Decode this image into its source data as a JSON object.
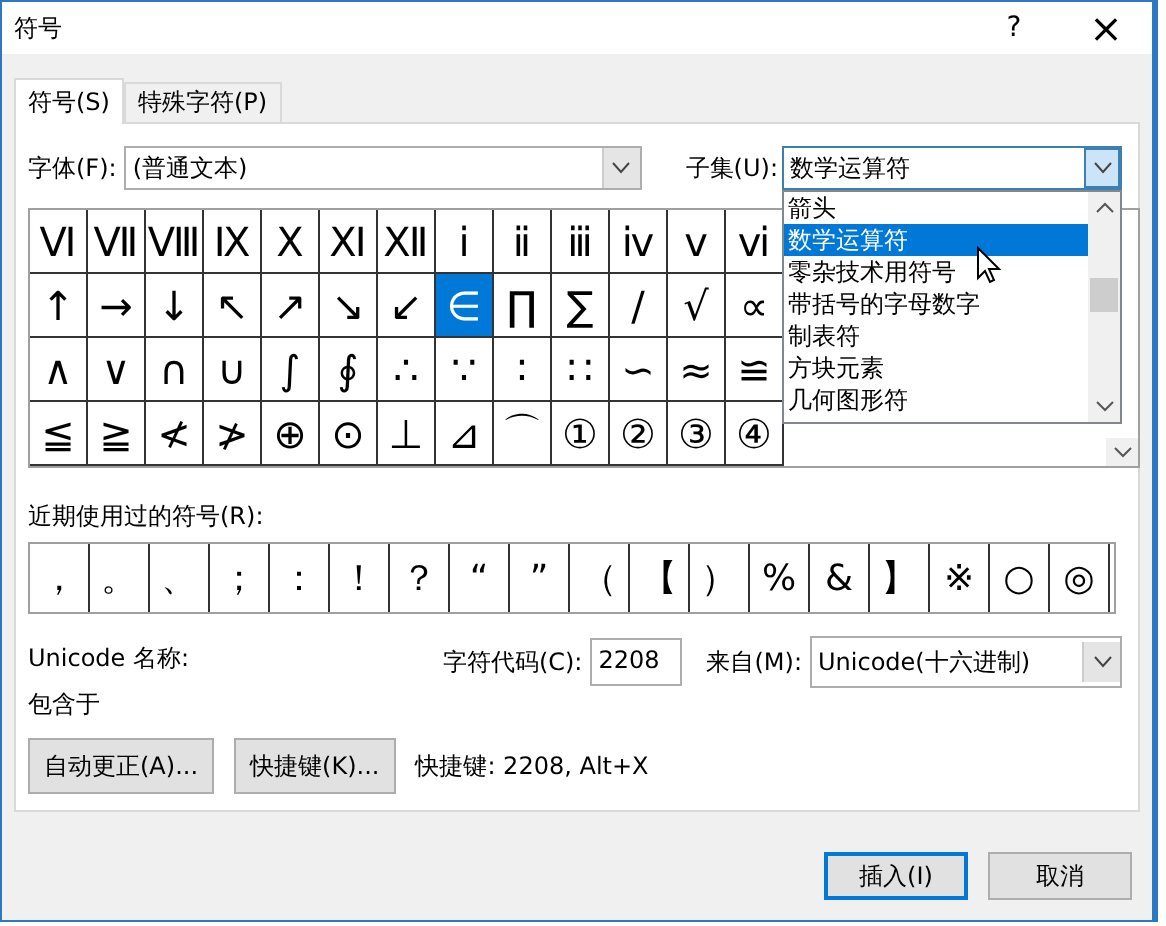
{
  "window": {
    "title": "符号",
    "help": "?",
    "close": "×"
  },
  "tabs": [
    {
      "label": "符号(S)",
      "selected": true
    },
    {
      "label": "特殊字符(P)",
      "selected": false
    }
  ],
  "font": {
    "label": "字体(F):",
    "value": "(普通文本)"
  },
  "subset": {
    "label": "子集(U):",
    "value": "数学运算符",
    "expanded": true,
    "options": [
      {
        "label": "箭头",
        "selected": false
      },
      {
        "label": "数学运算符",
        "selected": true
      },
      {
        "label": "零杂技术用符号",
        "selected": false
      },
      {
        "label": "带括号的字母数字",
        "selected": false
      },
      {
        "label": "制表符",
        "selected": false
      },
      {
        "label": "方块元素",
        "selected": false
      },
      {
        "label": "几何图形符",
        "selected": false
      }
    ]
  },
  "symbols": [
    [
      {
        "c": "Ⅵ",
        "selected": false
      },
      {
        "c": "Ⅶ",
        "selected": false
      },
      {
        "c": "Ⅷ",
        "selected": false
      },
      {
        "c": "Ⅸ",
        "selected": false
      },
      {
        "c": "Ⅹ",
        "selected": false
      },
      {
        "c": "Ⅺ",
        "selected": false
      },
      {
        "c": "Ⅻ",
        "selected": false
      },
      {
        "c": "ⅰ",
        "selected": false
      },
      {
        "c": "ⅱ",
        "selected": false
      },
      {
        "c": "ⅲ",
        "selected": false
      },
      {
        "c": "ⅳ",
        "selected": false
      },
      {
        "c": "ⅴ",
        "selected": false
      },
      {
        "c": "ⅵ",
        "selected": false
      }
    ],
    [
      {
        "c": "↑",
        "selected": false
      },
      {
        "c": "→",
        "selected": false
      },
      {
        "c": "↓",
        "selected": false
      },
      {
        "c": "↖",
        "selected": false
      },
      {
        "c": "↗",
        "selected": false
      },
      {
        "c": "↘",
        "selected": false
      },
      {
        "c": "↙",
        "selected": false
      },
      {
        "c": "∈",
        "selected": true
      },
      {
        "c": "∏",
        "selected": false
      },
      {
        "c": "∑",
        "selected": false
      },
      {
        "c": "∕",
        "selected": false
      },
      {
        "c": "√",
        "selected": false
      },
      {
        "c": "∝",
        "selected": false
      }
    ],
    [
      {
        "c": "∧",
        "selected": false
      },
      {
        "c": "∨",
        "selected": false
      },
      {
        "c": "∩",
        "selected": false
      },
      {
        "c": "∪",
        "selected": false
      },
      {
        "c": "∫",
        "selected": false
      },
      {
        "c": "∮",
        "selected": false
      },
      {
        "c": "∴",
        "selected": false
      },
      {
        "c": "∵",
        "selected": false
      },
      {
        "c": "∶",
        "selected": false
      },
      {
        "c": "∷",
        "selected": false
      },
      {
        "c": "∽",
        "selected": false
      },
      {
        "c": "≈",
        "selected": false
      },
      {
        "c": "≌",
        "selected": false
      }
    ],
    [
      {
        "c": "≦",
        "selected": false
      },
      {
        "c": "≧",
        "selected": false
      },
      {
        "c": "≮",
        "selected": false
      },
      {
        "c": "≯",
        "selected": false
      },
      {
        "c": "⊕",
        "selected": false
      },
      {
        "c": "⊙",
        "selected": false
      },
      {
        "c": "⊥",
        "selected": false
      },
      {
        "c": "⊿",
        "selected": false
      },
      {
        "c": "⌒",
        "selected": false
      },
      {
        "c": "①",
        "selected": false
      },
      {
        "c": "②",
        "selected": false
      },
      {
        "c": "③",
        "selected": false
      },
      {
        "c": "④",
        "selected": false
      }
    ]
  ],
  "recent": {
    "label": "近期使用过的符号(R):",
    "symbols": [
      "，",
      "。",
      "、",
      "；",
      "：",
      "！",
      "？",
      "“",
      "”",
      "（",
      "【",
      "）",
      "%",
      "&",
      "】",
      "※",
      "○",
      "◎"
    ]
  },
  "unicode_name": {
    "label": "Unicode 名称:"
  },
  "char_code": {
    "label": "字符代码(C):",
    "value": "2208"
  },
  "from": {
    "label": "来自(M):",
    "value": "Unicode(十六进制)"
  },
  "contained_in": "包含于",
  "buttons": [
    {
      "label": "自动更正(A)..."
    },
    {
      "label": "快捷键(K)..."
    }
  ],
  "shortcut_text": "快捷键: 2208, Alt+X",
  "footer_buttons": [
    {
      "label": "插入(I)"
    },
    {
      "label": "取消"
    }
  ]
}
